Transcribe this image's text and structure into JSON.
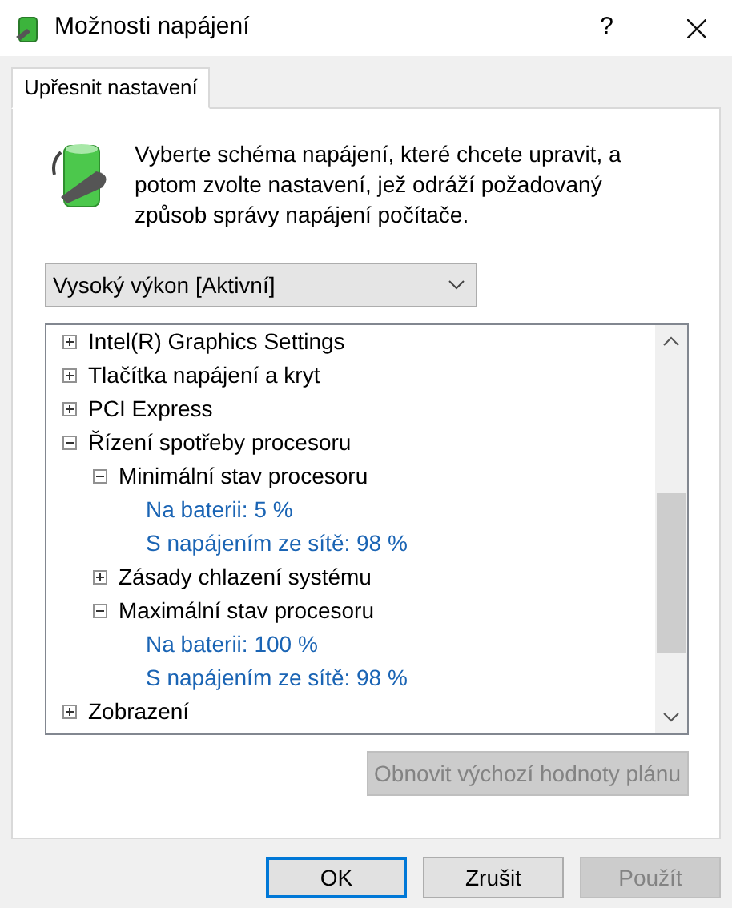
{
  "window": {
    "title": "Možnosti napájení",
    "help": "?"
  },
  "tabs": [
    {
      "label": "Upřesnit nastavení",
      "selected": true
    }
  ],
  "intro": "Vyberte schéma napájení, které chcete upravit, a potom zvolte nastavení, jež odráží požadovaný způsob správy napájení počítače.",
  "plan_select": {
    "value": "Vysoký výkon [Aktivní]"
  },
  "tree": [
    {
      "kind": "setting",
      "label": "Intel(R) Graphics Settings",
      "expanded": false
    },
    {
      "kind": "setting",
      "label": "Tlačítka napájení a kryt",
      "expanded": false
    },
    {
      "kind": "setting",
      "label": "PCI Express",
      "expanded": false
    },
    {
      "kind": "setting",
      "label": "Řízení spotřeby procesoru",
      "expanded": true,
      "children": [
        {
          "kind": "setting",
          "label": "Minimální stav procesoru",
          "expanded": true,
          "children": [
            {
              "kind": "value",
              "label": "Na baterii: 5 %"
            },
            {
              "kind": "value",
              "label": "S napájením ze sítě: 98 %"
            }
          ]
        },
        {
          "kind": "setting",
          "label": "Zásady chlazení systému",
          "expanded": false
        },
        {
          "kind": "setting",
          "label": "Maximální stav procesoru",
          "expanded": true,
          "children": [
            {
              "kind": "value",
              "label": "Na baterii: 100 %"
            },
            {
              "kind": "value",
              "label": "S napájením ze sítě: 98 %"
            }
          ]
        }
      ]
    },
    {
      "kind": "setting",
      "label": "Zobrazení",
      "expanded": false
    }
  ],
  "restore_button": {
    "label": "Obnovit výchozí hodnoty plánu",
    "disabled": true
  },
  "buttons": [
    {
      "label": "OK",
      "default": true,
      "disabled": false
    },
    {
      "label": "Zrušit",
      "default": false,
      "disabled": false
    },
    {
      "label": "Použít",
      "default": false,
      "disabled": true
    }
  ]
}
